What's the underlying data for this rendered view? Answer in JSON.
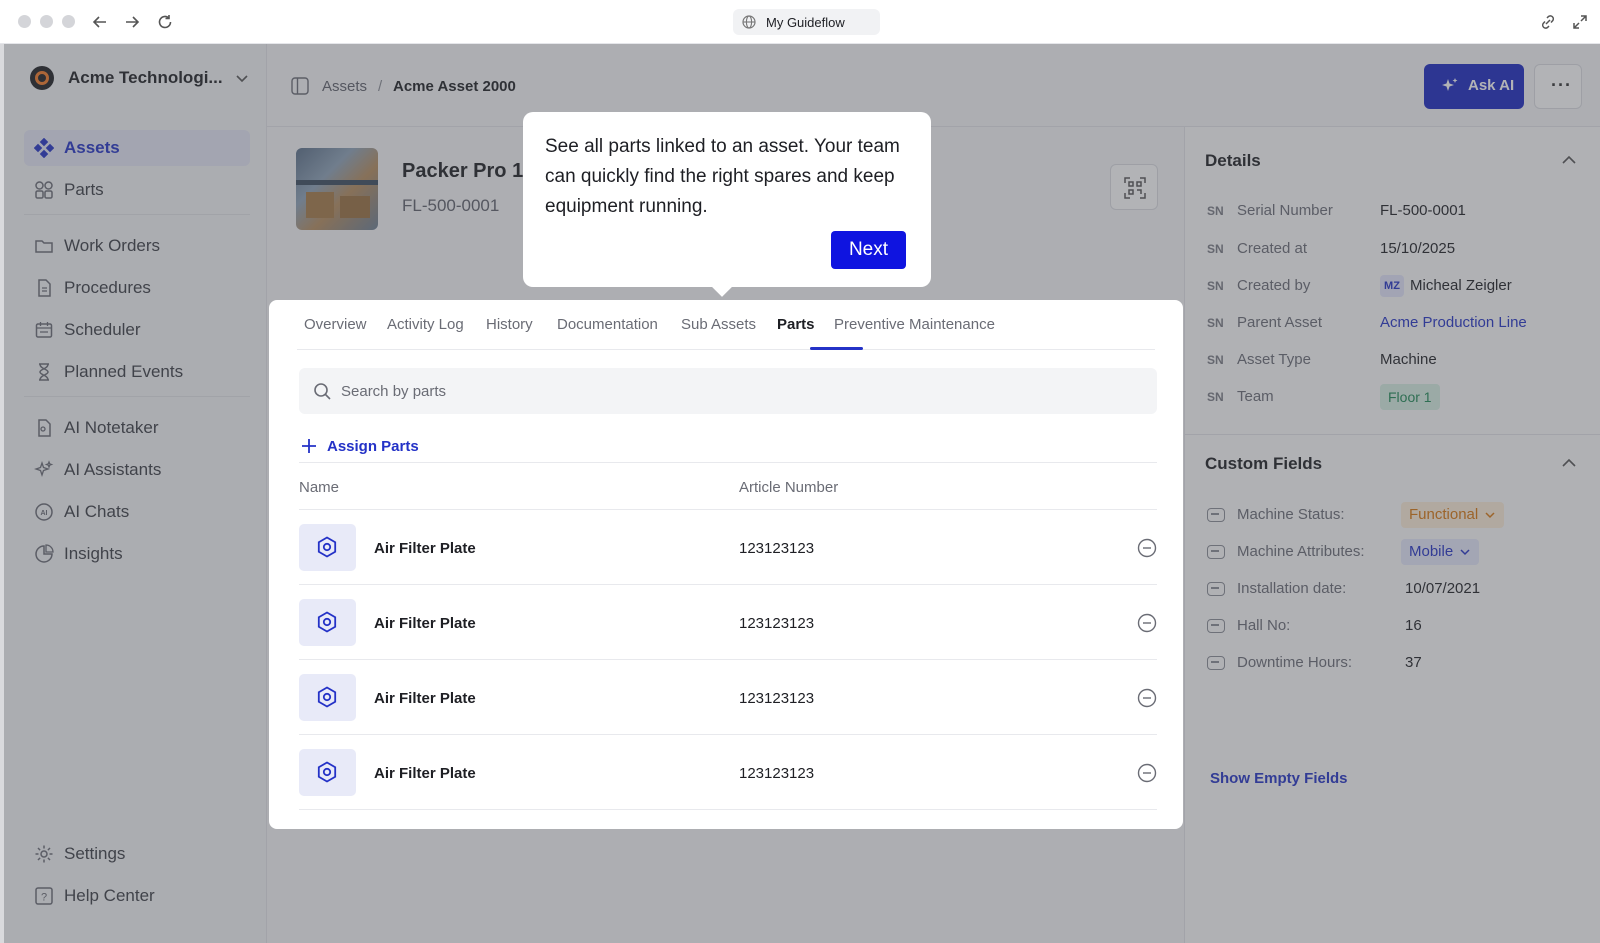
{
  "browser": {
    "url_title": "My Guideflow"
  },
  "sidebar": {
    "org_name": "Acme Technologi...",
    "items": [
      {
        "label": "Assets",
        "icon": "assets-icon",
        "active": true
      },
      {
        "label": "Parts",
        "icon": "parts-icon"
      },
      {
        "label": "Work Orders",
        "icon": "folder-icon"
      },
      {
        "label": "Procedures",
        "icon": "document-icon"
      },
      {
        "label": "Scheduler",
        "icon": "calendar-icon"
      },
      {
        "label": "Planned Events",
        "icon": "hourglass-icon"
      },
      {
        "label": "AI Notetaker",
        "icon": "notetaker-icon"
      },
      {
        "label": "AI Assistants",
        "icon": "sparkles-icon"
      },
      {
        "label": "AI Chats",
        "icon": "ai-chat-icon"
      },
      {
        "label": "Insights",
        "icon": "chart-icon"
      },
      {
        "label": "Settings",
        "icon": "gear-icon"
      },
      {
        "label": "Help Center",
        "icon": "help-icon"
      }
    ]
  },
  "header": {
    "breadcrumb_root": "Assets",
    "breadcrumb_sep": "/",
    "breadcrumb_current": "Acme Asset 2000",
    "ask_ai_label": "Ask AI",
    "more_label": "···"
  },
  "asset": {
    "title": "Packer Pro 10",
    "serial": "FL-500-0001"
  },
  "tabs": [
    "Overview",
    "Activity Log",
    "History",
    "Documentation",
    "Sub Assets",
    "Parts",
    "Preventive Maintenance"
  ],
  "active_tab": "Parts",
  "parts": {
    "search_placeholder": "Search by parts",
    "assign_label": "Assign Parts",
    "col_name": "Name",
    "col_article": "Article Number",
    "rows": [
      {
        "name": "Air Filter Plate",
        "article": "123123123"
      },
      {
        "name": "Air Filter Plate",
        "article": "123123123"
      },
      {
        "name": "Air Filter Plate",
        "article": "123123123"
      },
      {
        "name": "Air Filter Plate",
        "article": "123123123"
      }
    ]
  },
  "details": {
    "title": "Details",
    "prefix": "SN",
    "rows": [
      {
        "key": "Serial Number",
        "value": "FL-500-0001"
      },
      {
        "key": "Created at",
        "value": "15/10/2025"
      },
      {
        "key": "Created by",
        "value": "Micheal Zeigler",
        "avatar": "MZ"
      },
      {
        "key": "Parent Asset",
        "value": "Acme Production Line"
      },
      {
        "key": "Asset Type",
        "value": "Machine"
      },
      {
        "key": "Team",
        "value": "Floor 1"
      }
    ]
  },
  "custom_fields": {
    "title": "Custom Fields",
    "rows": [
      {
        "key": "Machine Status:",
        "value": "Functional"
      },
      {
        "key": "Machine Attributes:",
        "value": "Mobile"
      },
      {
        "key": "Installation date:",
        "value": "10/07/2021"
      },
      {
        "key": "Hall No:",
        "value": "16"
      },
      {
        "key": "Downtime Hours:",
        "value": "37"
      }
    ],
    "show_empty_label": "Show Empty Fields"
  },
  "tooltip": {
    "text": "See all parts linked to an asset. Your team can quickly find the right spares and keep equipment running.",
    "next_label": "Next"
  },
  "colors": {
    "accent": "#2432c7",
    "next_button": "#0f14e0",
    "status_orange": "#d9770f",
    "team_green": "#1e8a55"
  }
}
